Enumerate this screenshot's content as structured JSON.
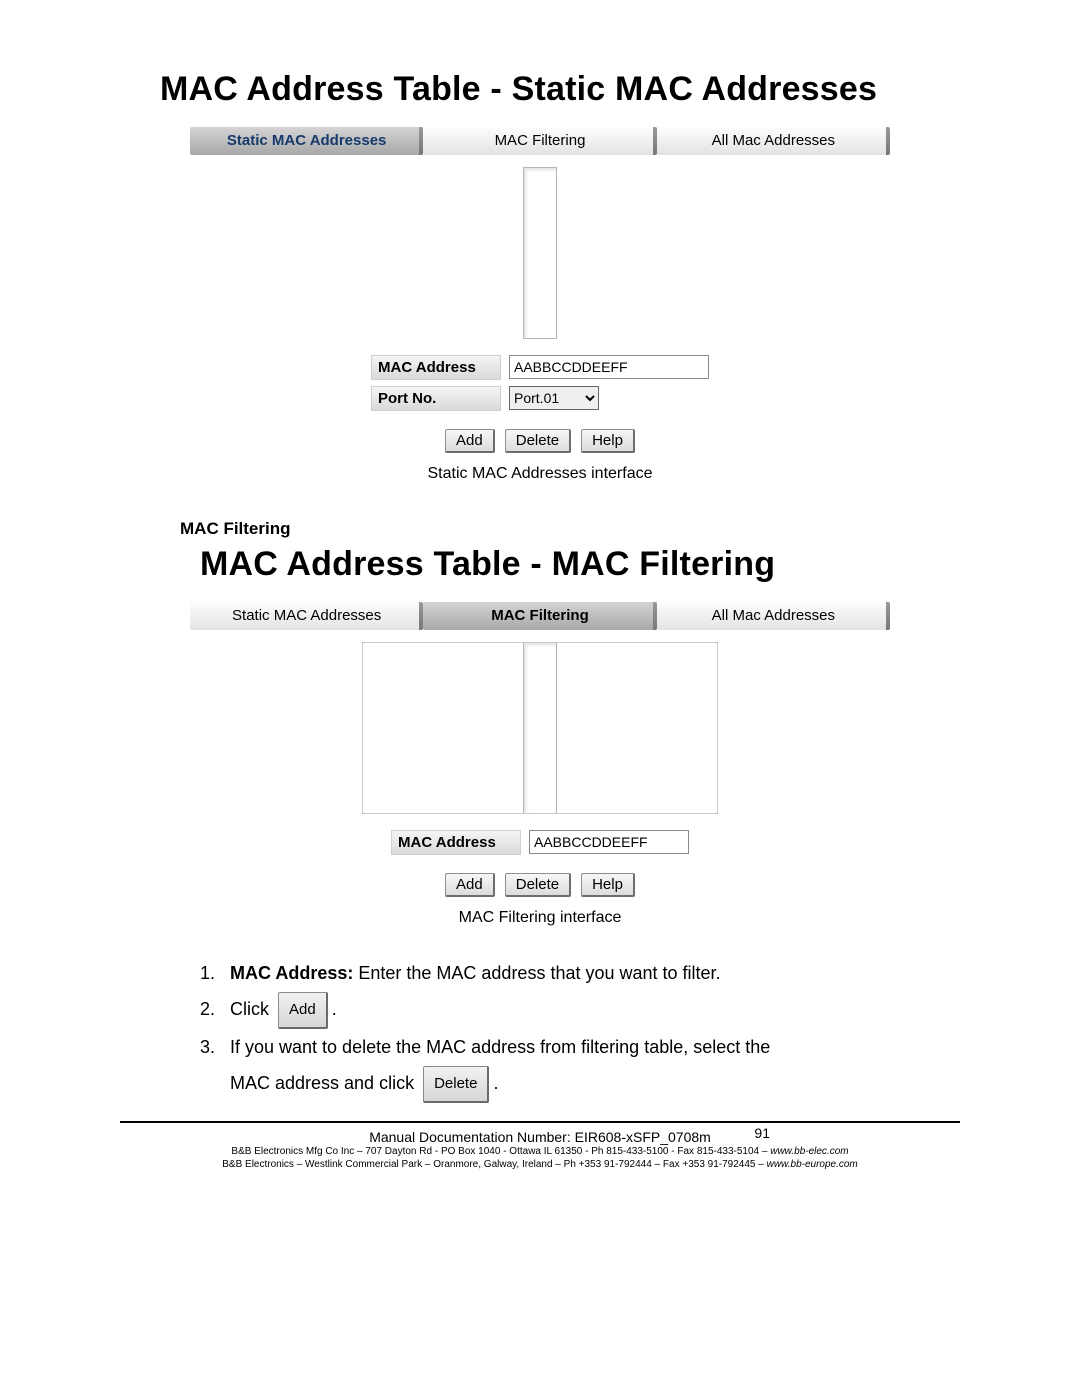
{
  "panel1": {
    "title": "MAC Address Table - Static MAC Addresses",
    "tabs": [
      "Static MAC Addresses",
      "MAC Filtering",
      "All Mac Addresses"
    ],
    "active_tab_index": 0,
    "mac_address_label": "MAC Address",
    "mac_address_value": "AABBCCDDEEFF",
    "port_label": "Port No.",
    "port_value": "Port.01",
    "buttons": {
      "add": "Add",
      "delete": "Delete",
      "help": "Help"
    },
    "caption": "Static MAC Addresses interface"
  },
  "section_heading": "MAC Filtering",
  "panel2": {
    "title": "MAC Address Table - MAC Filtering",
    "tabs": [
      "Static MAC Addresses",
      "MAC Filtering",
      "All Mac Addresses"
    ],
    "active_tab_index": 1,
    "mac_address_label": "MAC Address",
    "mac_address_value": "AABBCCDDEEFF",
    "buttons": {
      "add": "Add",
      "delete": "Delete",
      "help": "Help"
    },
    "caption": "MAC Filtering interface"
  },
  "instructions": {
    "step1_label": "MAC Address:",
    "step1_text": " Enter the MAC address that you want to filter.",
    "step2_prefix": "Click ",
    "step2_button": "Add",
    "step2_suffix": ".",
    "step3_line1": "If you want to delete the MAC address from filtering table, select the",
    "step3_line2_prefix": "MAC address and click ",
    "step3_button": "Delete",
    "step3_line2_suffix": "."
  },
  "footer": {
    "doc_line": "Manual Documentation Number: EIR608-xSFP_0708m",
    "page_number": "91",
    "line1_a": "B&B Electronics Mfg Co Inc – 707 Dayton Rd - PO Box 1040 - Ottawa IL 61350 - Ph 815-433-5100 - Fax 815-433-5104 – ",
    "line1_b": "www.bb-elec.com",
    "line2_a": "B&B Electronics – Westlink Commercial Park – Oranmore, Galway, Ireland – Ph +353 91-792444 – Fax +353 91-792445 – ",
    "line2_b": "www.bb-europe.com"
  }
}
